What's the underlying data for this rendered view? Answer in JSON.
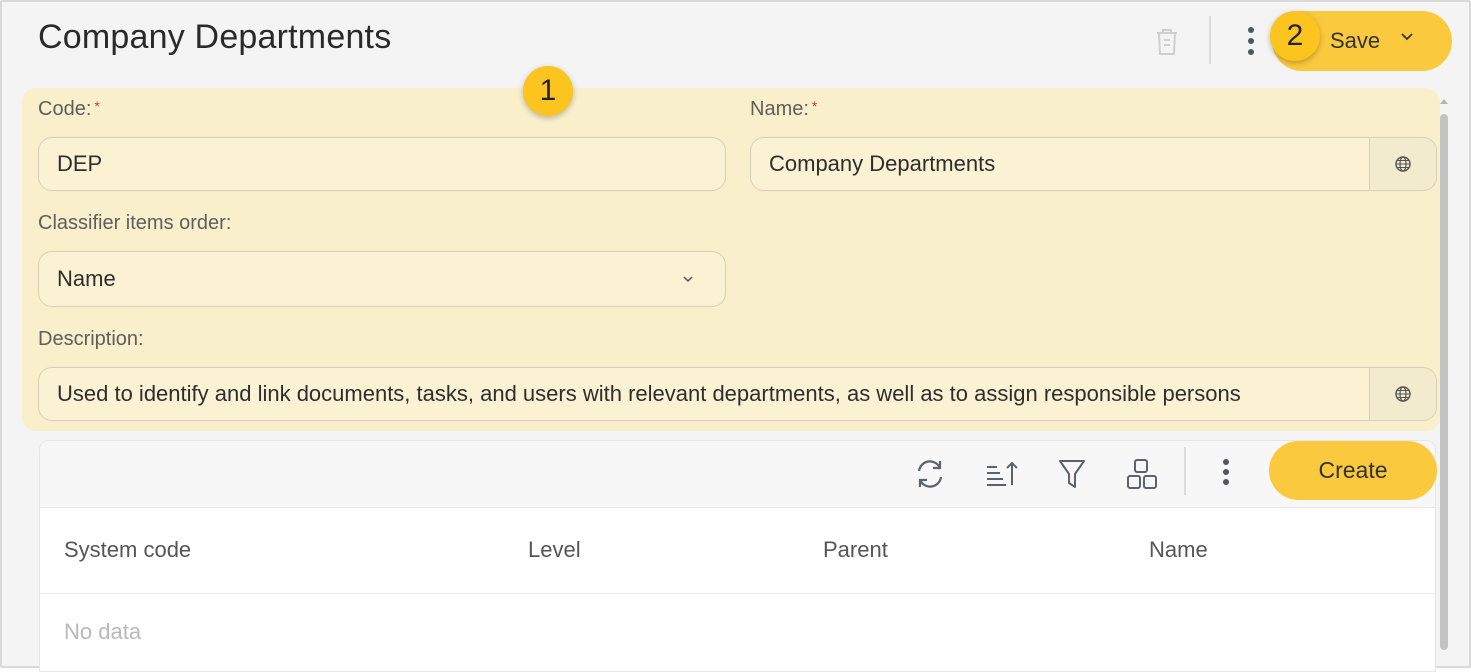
{
  "header": {
    "title": "Company Departments",
    "save_label": "Save",
    "icons": {
      "delete": "trash-icon",
      "more": "more-vertical-icon",
      "save_dropdown": "chevron-down-icon"
    }
  },
  "badges": {
    "one": "1",
    "two": "2"
  },
  "form": {
    "code_label": "Code:",
    "code_required": "*",
    "code_value": "DEP",
    "name_label": "Name:",
    "name_required": "*",
    "name_value": "Company Departments",
    "order_label": "Classifier items order:",
    "order_value": "Name",
    "description_label": "Description:",
    "description_value": "Used to identify and link documents, tasks, and users with relevant departments, as well as to assign responsible persons",
    "translate_icon": "globe-icon"
  },
  "toolbar": {
    "icons": [
      "refresh-icon",
      "sort-icon",
      "filter-icon",
      "group-icon",
      "more-vertical-icon"
    ],
    "create_label": "Create"
  },
  "table": {
    "columns": [
      "System code",
      "Level",
      "Parent",
      "Name"
    ],
    "empty_text": "No data"
  },
  "colors": {
    "accent": "#fbc93d",
    "badge": "#fbc41f",
    "highlight": "#f9efcb"
  }
}
